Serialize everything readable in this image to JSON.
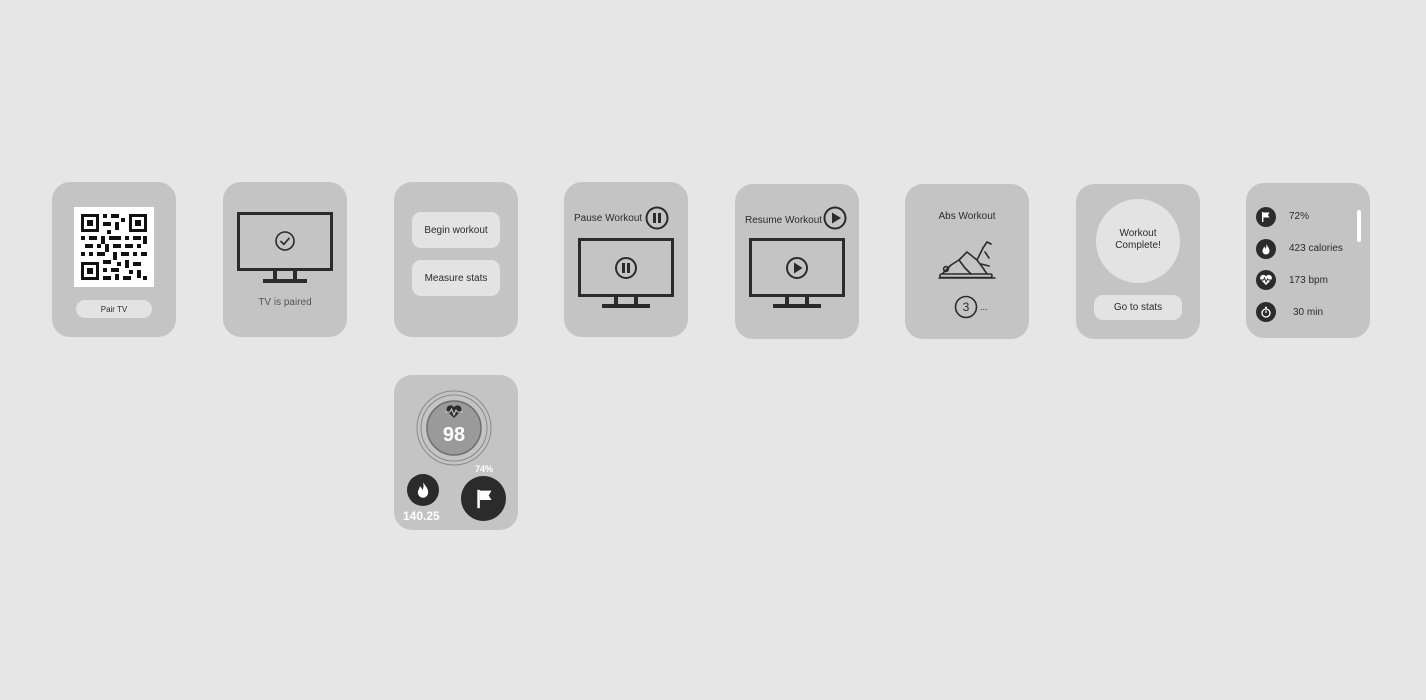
{
  "screens": {
    "pair": {
      "button": "Pair TV"
    },
    "paired": {
      "status": "TV is paired"
    },
    "menu": {
      "begin": "Begin workout",
      "measure": "Measure stats"
    },
    "pause": {
      "title": "Pause Workout"
    },
    "resume": {
      "title": "Resume Workout"
    },
    "abs": {
      "title": "Abs Workout",
      "countdown": "3",
      "ellipsis": "..."
    },
    "complete": {
      "line1": "Workout",
      "line2": "Complete!",
      "button": "Go to stats"
    },
    "stats": {
      "items": [
        {
          "icon": "flag-icon",
          "value": "72%"
        },
        {
          "icon": "flame-icon",
          "value": "423 calories"
        },
        {
          "icon": "heart-rate-icon",
          "value": "173 bpm"
        },
        {
          "icon": "stopwatch-icon",
          "value": "30 min"
        }
      ]
    },
    "live": {
      "heart": "98",
      "calories": "140.25",
      "percent": "74%"
    }
  },
  "colors": {
    "screen": "#c4c4c4",
    "background": "#e6e6e6",
    "dark": "#2b2b2b",
    "pill": "#e3e3e3"
  }
}
